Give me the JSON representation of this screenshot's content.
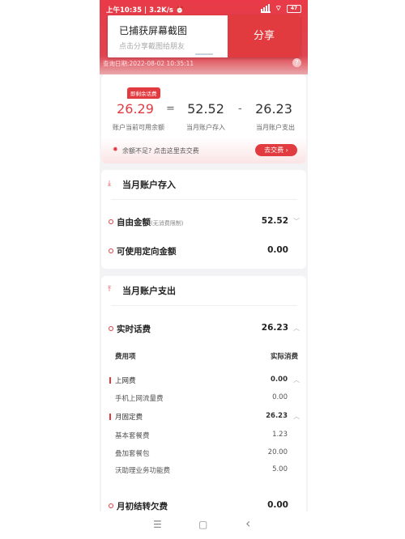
{
  "status_bar": {
    "left": "上午10:35 | 3.2K/s ⏰",
    "battery": "47"
  },
  "screenshot_toast": {
    "title": "已捕获屏幕截图",
    "subtitle": "点击分享截图给朋友",
    "share_label": "分享"
  },
  "query_date": "查询日期:2022-08-02 10:35:11",
  "help_label": "?",
  "summary": {
    "tag": "即剩余话费",
    "balance_value": "26.29",
    "balance_label": "账户当前可用余额",
    "equals": "=",
    "deposit_value": "52.52",
    "deposit_label": "当月账户存入",
    "minus": "-",
    "expense_value": "26.23",
    "expense_label": "当月账户支出",
    "hint": "余额不足? 点击这里去交费",
    "pay_button": "去交费 ›"
  },
  "deposit_section": {
    "title": "当月账户存入",
    "rows": [
      {
        "label": "自由金额",
        "note": "(无消费限制)",
        "value": "52.52"
      },
      {
        "label": "可使用定向金额",
        "note": "",
        "value": "0.00"
      }
    ]
  },
  "expense_section": {
    "title": "当月账户支出",
    "realtime_label": "实时话费",
    "realtime_value": "26.23",
    "table_header": {
      "item": "费用项",
      "actual": "实际消费"
    },
    "groups": [
      {
        "name": "上网费",
        "value": "0.00",
        "items": [
          {
            "name": "手机上网流量费",
            "value": "0.00"
          }
        ]
      },
      {
        "name": "月固定费",
        "value": "26.23",
        "items": [
          {
            "name": "基本套餐费",
            "value": "1.23"
          },
          {
            "name": "叠加套餐包",
            "value": "20.00"
          },
          {
            "name": "沃助理业务功能费",
            "value": "5.00"
          }
        ]
      }
    ],
    "carryover_label": "月初结转欠费",
    "carryover_value": "0.00"
  },
  "nav": {
    "menu": "☰",
    "home": "▢",
    "back": "‹"
  }
}
